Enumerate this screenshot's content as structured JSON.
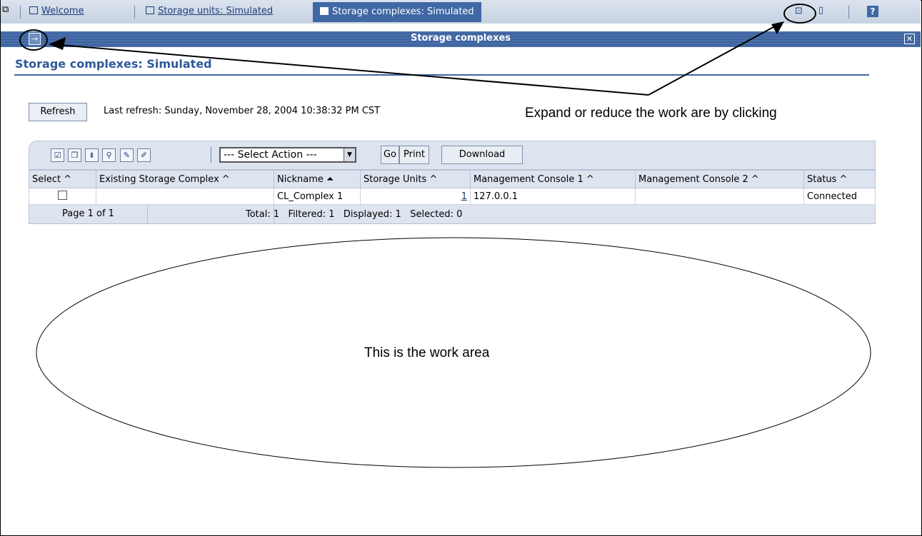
{
  "tabs": [
    {
      "label": "Welcome"
    },
    {
      "label": "Storage units: Simulated"
    },
    {
      "label": "Storage complexes: Simulated"
    }
  ],
  "titlebar": {
    "title": "Storage complexes"
  },
  "page_title": "Storage complexes: Simulated",
  "refresh": {
    "label": "Refresh",
    "last_refresh": "Last refresh: Sunday, November 28, 2004 10:38:32 PM CST"
  },
  "annotation_note": "Expand or reduce the work are by clicking",
  "toolbar": {
    "select_action": "--- Select Action ---",
    "go": "Go",
    "print": "Print",
    "download": "Download"
  },
  "table": {
    "headers": [
      "Select ^",
      "Existing Storage Complex ^",
      "Nickname ⏶",
      "Storage Units ^",
      "Management Console 1 ^",
      "Management Console 2 ^",
      "Status ^"
    ],
    "rows": [
      {
        "existing": "",
        "nickname": "CL_Complex 1",
        "storage_units": "1",
        "mc1": "127.0.0.1",
        "mc2": "",
        "status": "Connected"
      }
    ],
    "footer": {
      "page": "Page 1 of 1",
      "summary": "Total: 1   Filtered: 1   Displayed: 1   Selected: 0"
    }
  },
  "work_area_label": "This is the work area"
}
